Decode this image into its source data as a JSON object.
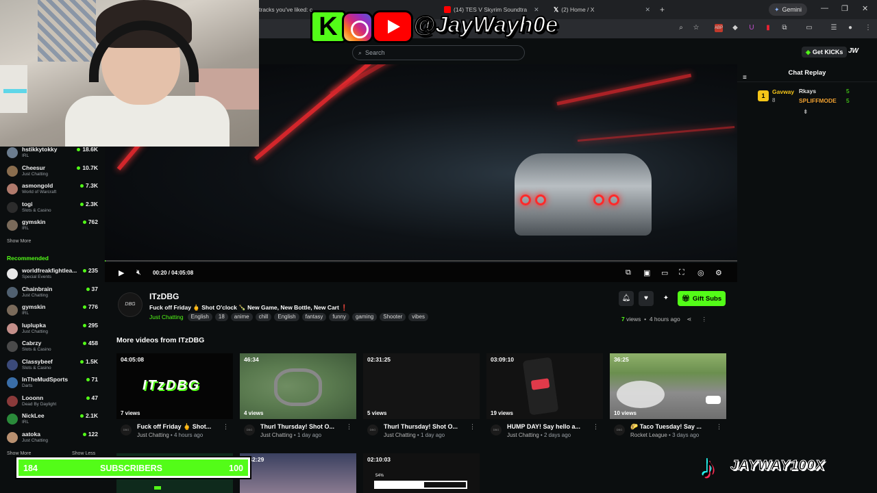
{
  "browser": {
    "tabs": [
      {
        "label": "tracks you've liked: c"
      },
      {
        "label": "(14) TES V Skyrim Soundtra"
      },
      {
        "label": "(2) Home / X"
      }
    ],
    "gemini_label": "Gemini",
    "window_controls": [
      "—",
      "❐",
      "✕"
    ]
  },
  "kick": {
    "search_placeholder": "Search",
    "get_kicks_label": "Get KICKs",
    "user_badge": "JW"
  },
  "sidebar": {
    "following": [
      {
        "name": "hstikkytokky",
        "category": "IRL",
        "viewers": "18.6K",
        "color": "#6b7c8e"
      },
      {
        "name": "Cheesur",
        "category": "Just Chatting",
        "viewers": "10.7K",
        "color": "#8a6d4e"
      },
      {
        "name": "asmongold",
        "category": "World of Warcraft",
        "viewers": "7.3K",
        "color": "#b07a6c"
      },
      {
        "name": "togi",
        "category": "Slots & Casino",
        "viewers": "2.3K",
        "color": "#2c2c2c"
      },
      {
        "name": "gymskin",
        "category": "IRL",
        "viewers": "762",
        "color": "#7a6a5a"
      }
    ],
    "show_more": "Show More",
    "recommended_title": "Recommended",
    "recommended": [
      {
        "name": "worldfreakfightlea...",
        "category": "Special Events",
        "viewers": "235",
        "color": "#e8e8e8"
      },
      {
        "name": "Chainbrain",
        "category": "Just Chatting",
        "viewers": "37",
        "color": "#506070"
      },
      {
        "name": "gymskin",
        "category": "IRL",
        "viewers": "776",
        "color": "#7a6a5a"
      },
      {
        "name": "luplupka",
        "category": "Just Chatting",
        "viewers": "295",
        "color": "#c48f8a"
      },
      {
        "name": "Cabrzy",
        "category": "Slots & Casino",
        "viewers": "458",
        "color": "#4a4a4a"
      },
      {
        "name": "Classybeef",
        "category": "Slots & Casino",
        "viewers": "1.5K",
        "color": "#3b4a7a"
      },
      {
        "name": "InTheMudSports",
        "category": "Darts",
        "viewers": "71",
        "color": "#3a6ea8"
      },
      {
        "name": "Looonn",
        "category": "Dead By Daylight",
        "viewers": "47",
        "color": "#8a3a3a"
      },
      {
        "name": "NickLee",
        "category": "IRL",
        "viewers": "2.1K",
        "color": "#2a8a3a"
      },
      {
        "name": "aatoka",
        "category": "Just Chatting",
        "viewers": "122",
        "color": "#b89070"
      }
    ],
    "show_more_2": "Show More",
    "show_less": "Show Less"
  },
  "player": {
    "current_time": "00:20",
    "separator": "/",
    "duration": "04:05:08",
    "progress": 0.0014
  },
  "chat": {
    "title": "Chat Replay",
    "leaderboard": [
      {
        "rank": "1",
        "name": "Gavway",
        "value": "8"
      },
      {
        "name": "Rkays",
        "value": "5"
      },
      {
        "name": "SPLIFFMODE",
        "value": "5"
      }
    ]
  },
  "channel": {
    "avatar_text": "DBG",
    "name": "ITzDBG",
    "stream_title": "Fuck off Friday 🖕 Shot O'clock 🍾 New Game, New Bottle, New Cart ❗",
    "category": "Just Chatting",
    "tags": [
      "English",
      "18",
      "anime",
      "chill",
      "English",
      "fantasy",
      "funny",
      "gaming",
      "Shooter",
      "vibes"
    ],
    "gift_label": "Gift Subs",
    "views_count": "7",
    "views_word": "views",
    "dot": "•",
    "time_ago": "4 hours ago"
  },
  "more_videos": {
    "title": "More videos from ITzDBG",
    "cards": [
      {
        "duration": "04:05:08",
        "views": "7 views",
        "title": "Fuck off Friday 🖕 Shot...",
        "category": "Just Chatting",
        "age": "4 hours ago",
        "thumb_text": "ITzDBG"
      },
      {
        "duration": "46:34",
        "views": "4 views",
        "title": "Thurl Thursday! Shot O...",
        "category": "Just Chatting",
        "age": "1 day ago",
        "thumb_text": ""
      },
      {
        "duration": "02:31:25",
        "views": "5 views",
        "title": "Thurl Thursday! Shot O...",
        "category": "Just Chatting",
        "age": "1 day ago",
        "thumb_text": ""
      },
      {
        "duration": "03:09:10",
        "views": "19 views",
        "title": "HUMP DAY! Say hello a...",
        "category": "Just Chatting",
        "age": "2 days ago",
        "thumb_text": ""
      },
      {
        "duration": "36:25",
        "views": "10 views",
        "title": "🌮 Taco Tuesday! Say ...",
        "category": "Rocket League",
        "age": "3 days ago",
        "thumb_text": ""
      }
    ],
    "row2": [
      {
        "duration": ""
      },
      {
        "duration": "2:42:29"
      },
      {
        "duration": "02:10:03",
        "percent": "54%"
      }
    ]
  },
  "overlay": {
    "handle": "@JayWayh0e",
    "subs_current": "184",
    "subs_label": "SUBSCRIBERS",
    "subs_goal": "100",
    "tiktok_handle": "JAYWAY100X"
  }
}
